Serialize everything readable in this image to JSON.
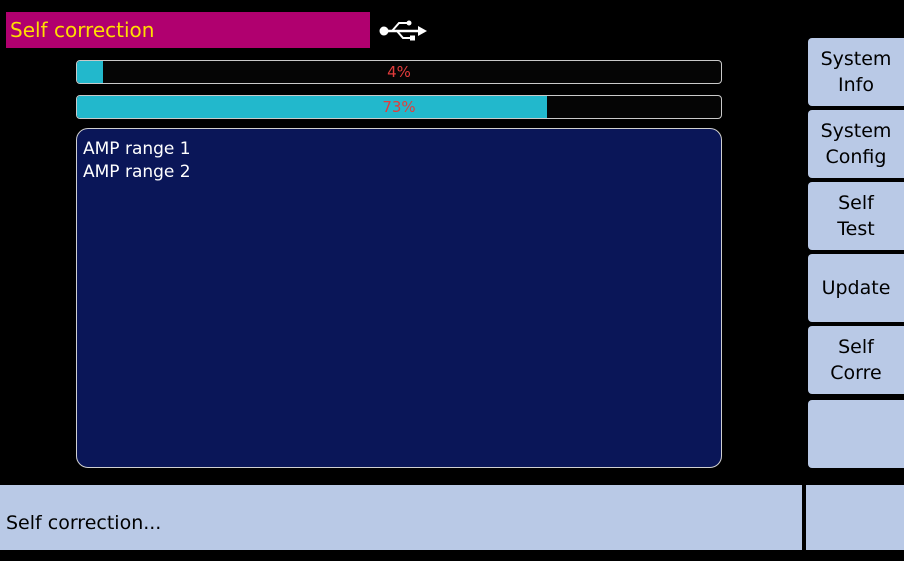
{
  "header": {
    "title": "Self correction",
    "title_bg": "#b0006f",
    "title_color": "#ffde00",
    "usb_icon": "usb-icon"
  },
  "progress": [
    {
      "label": "4%",
      "value": 0.04
    },
    {
      "label": "73%",
      "value": 0.73
    }
  ],
  "log": {
    "lines": [
      "AMP range  1",
      "AMP range  2"
    ]
  },
  "menu": {
    "items": [
      {
        "label": "System\nInfo"
      },
      {
        "label": "System\nConfig"
      },
      {
        "label": "Self\nTest"
      },
      {
        "label": "Update"
      },
      {
        "label": "Self\nCorre"
      },
      {
        "label": ""
      }
    ]
  },
  "status": {
    "text": "Self correction..."
  },
  "colors": {
    "accent": "#22b8cc",
    "panel": "#0a1658",
    "button": "#b9c9e6",
    "progress_text": "#e23c3c"
  }
}
